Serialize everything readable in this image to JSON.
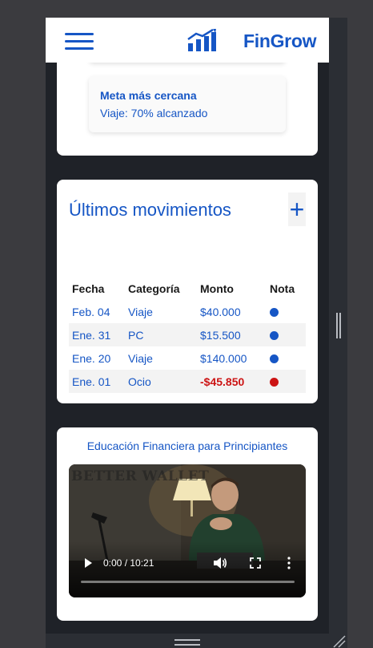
{
  "app": {
    "brand": "FinGrow"
  },
  "header": {
    "menu_icon": "hamburger-menu-icon",
    "logo_icon": "bar-chart-growth-icon"
  },
  "goal": {
    "title": "Meta más cercana",
    "text": "Viaje: 70% alcanzado"
  },
  "movements": {
    "title": "Últimos movimientos",
    "add_label": "+",
    "columns": [
      "Fecha",
      "Categoría",
      "Monto",
      "Nota"
    ],
    "rows": [
      {
        "date": "Feb. 04",
        "category": "Viaje",
        "amount": "$40.000",
        "note_color": "#1656c5"
      },
      {
        "date": "Ene. 31",
        "category": "PC",
        "amount": "$15.500",
        "note_color": "#1656c5"
      },
      {
        "date": "Ene. 20",
        "category": "Viaje",
        "amount": "$140.000",
        "note_color": "#1656c5"
      },
      {
        "date": "Ene. 01",
        "category": "Ocio",
        "amount": "-$45.850",
        "note_color": "#cc1414"
      }
    ]
  },
  "education": {
    "title": "Educación Financiera para Principiantes",
    "video": {
      "watermark": "BETTER WALLET",
      "time": "0:00 / 10:21",
      "progress": 0
    }
  },
  "colors": {
    "accent": "#1656c5",
    "negative": "#cc1414",
    "background": "#1f2228"
  }
}
